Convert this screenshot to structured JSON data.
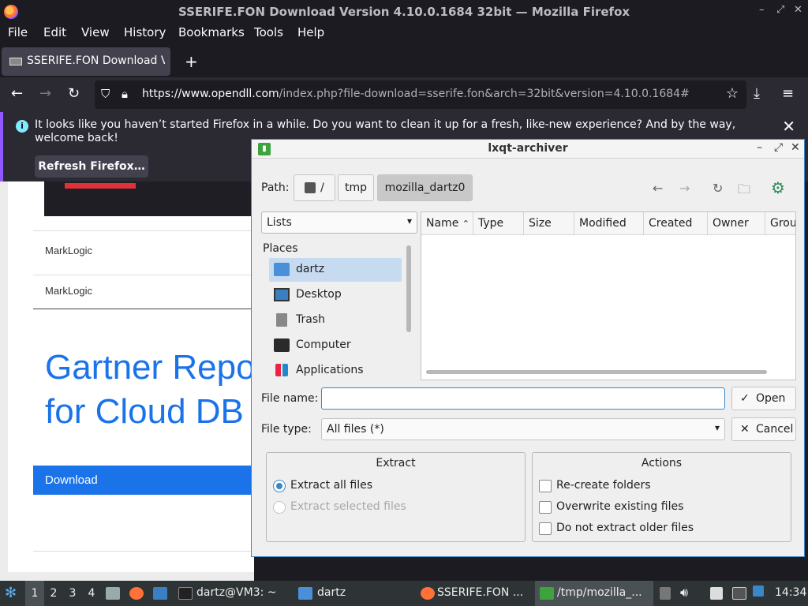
{
  "browser": {
    "window_title": "SSERIFE.FON Download Version 4.10.0.1684 32bit — Mozilla Firefox",
    "menu": [
      "File",
      "Edit",
      "View",
      "History",
      "Bookmarks",
      "Tools",
      "Help"
    ],
    "tab_title": "SSERIFE.FON Download V",
    "new_tab": "+",
    "url_host": "https://www.opendll.com",
    "url_path": "/index.php?file-download=sserife.fon&arch=32bit&version=4.10.0.1684#",
    "notification": {
      "message": "It looks like you haven’t started Firefox in a while. Do you want to clean it up for a fresh, like-new experience? And by the way, welcome back!",
      "button": "Refresh Firefox…"
    }
  },
  "page": {
    "vendor1": "MarkLogic",
    "vendor2": "MarkLogic",
    "headline_line1": "Gartner Repo",
    "headline_line2": "for Cloud DB",
    "download_button": "Download"
  },
  "dialog": {
    "title": "lxqt-archiver",
    "path_label": "Path:",
    "path_root": "/",
    "path_segments": [
      "tmp",
      "mozilla_dartz0"
    ],
    "view_combo": "Lists",
    "places_header": "Places",
    "places": [
      {
        "label": "dartz",
        "icon": "home-folder-icon",
        "selected": true
      },
      {
        "label": "Desktop",
        "icon": "desktop-icon",
        "selected": false
      },
      {
        "label": "Trash",
        "icon": "trash-icon",
        "selected": false
      },
      {
        "label": "Computer",
        "icon": "computer-icon",
        "selected": false
      },
      {
        "label": "Applications",
        "icon": "applications-icon",
        "selected": false
      }
    ],
    "columns": [
      "Name",
      "Type",
      "Size",
      "Modified",
      "Created",
      "Owner",
      "Grou"
    ],
    "file_name_label": "File name:",
    "file_name_value": "",
    "file_type_label": "File type:",
    "file_type_value": "All files (*)",
    "open_button": "Open",
    "cancel_button": "Cancel",
    "extract": {
      "title": "Extract",
      "all_files": "Extract all files",
      "selected_files": "Extract selected files",
      "selected": "all"
    },
    "actions": {
      "title": "Actions",
      "recreate": "Re-create folders",
      "overwrite": "Overwrite existing files",
      "no_older": "Do not extract older files"
    }
  },
  "taskbar": {
    "workspaces": [
      "1",
      "2",
      "3",
      "4"
    ],
    "active_workspace": "1",
    "tasks": [
      "dartz@VM3: ~",
      "dartz",
      "SSERIFE.FON ...",
      "/tmp/mozilla_..."
    ],
    "clock": "14:34"
  }
}
